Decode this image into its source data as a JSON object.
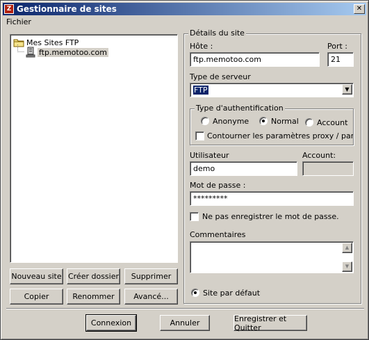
{
  "window": {
    "title": "Gestionnaire de sites",
    "app_icon_letter": "Z",
    "close_glyph": "✕"
  },
  "menu": {
    "file": "Fichier"
  },
  "tree": {
    "root_label": "Mes Sites FTP",
    "site_label": "ftp.memotoo.com"
  },
  "left_buttons": {
    "new_site": "Nouveau site",
    "new_folder": "Créer dossier",
    "delete": "Supprimer",
    "copy": "Copier",
    "rename": "Renommer",
    "advanced": "Avancé..."
  },
  "details": {
    "group_title": "Détails du site",
    "host_label": "Hôte :",
    "host_value": "ftp.memotoo.com",
    "port_label": "Port :",
    "port_value": "21",
    "server_type_label": "Type de serveur",
    "server_type_value": "FTP",
    "auth": {
      "group_title": "Type d'authentification",
      "anonymous": "Anonyme",
      "normal": "Normal",
      "account": "Account",
      "selected": "Normal",
      "bypass_proxy": "Contourner les paramètres proxy / pare-feu"
    },
    "user_label": "Utilisateur",
    "user_value": "demo",
    "account_label": "Account:",
    "account_value": "",
    "password_label": "Mot de passe :",
    "password_value": "*********",
    "dont_save_password": "Ne pas enregistrer le mot de passe.",
    "comments_label": "Commentaires",
    "comments_value": "",
    "default_site": "Site par défaut"
  },
  "bottom_buttons": {
    "connect": "Connexion",
    "cancel": "Annuler",
    "save_quit": "Enregistrer et Quitter"
  }
}
